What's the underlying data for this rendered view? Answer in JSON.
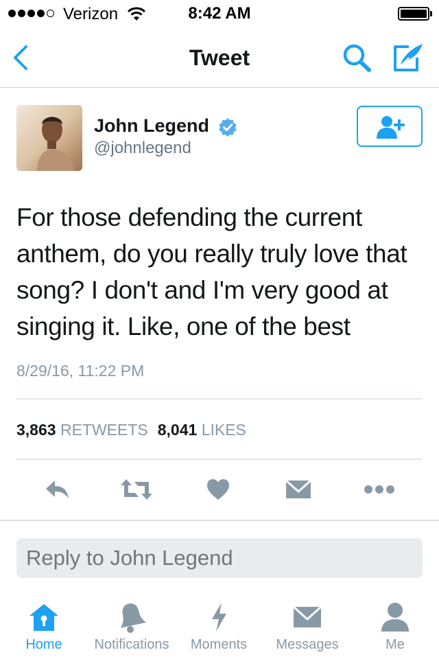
{
  "status_bar": {
    "carrier": "Verizon",
    "time": "8:42 AM",
    "signal_bars_filled": 4,
    "signal_bars_total": 5,
    "battery_level": 1.0
  },
  "nav": {
    "title": "Tweet",
    "back_icon": "chevron-left-icon",
    "search_icon": "search-icon",
    "compose_icon": "compose-icon"
  },
  "tweet": {
    "author_name": "John Legend",
    "author_handle": "@johnlegend",
    "verified": true,
    "text": "For those defending the current anthem, do you really truly love that song?  I don't and I'm very good at singing it. Like, one of the best",
    "timestamp": "8/29/16, 11:22 PM",
    "retweets_count": "3,863",
    "retweets_label": "RETWEETS",
    "likes_count": "8,041",
    "likes_label": "LIKES"
  },
  "actions": [
    {
      "name": "reply",
      "icon": "reply-icon"
    },
    {
      "name": "retweet",
      "icon": "retweet-icon"
    },
    {
      "name": "like",
      "icon": "heart-icon"
    },
    {
      "name": "direct-message",
      "icon": "envelope-icon"
    },
    {
      "name": "more",
      "icon": "more-icon"
    }
  ],
  "reply": {
    "placeholder": "Reply to John Legend"
  },
  "tab_bar": {
    "tabs": [
      {
        "label": "Home",
        "icon": "home-icon",
        "active": true
      },
      {
        "label": "Notifications",
        "icon": "bell-icon",
        "active": false
      },
      {
        "label": "Moments",
        "icon": "lightning-icon",
        "active": false
      },
      {
        "label": "Messages",
        "icon": "envelope-icon",
        "active": false
      },
      {
        "label": "Me",
        "icon": "person-icon",
        "active": false
      }
    ]
  },
  "colors": {
    "accent": "#1da1f2",
    "muted": "#8899a6",
    "icon_gray": "#8899a6",
    "text": "#14171a"
  }
}
